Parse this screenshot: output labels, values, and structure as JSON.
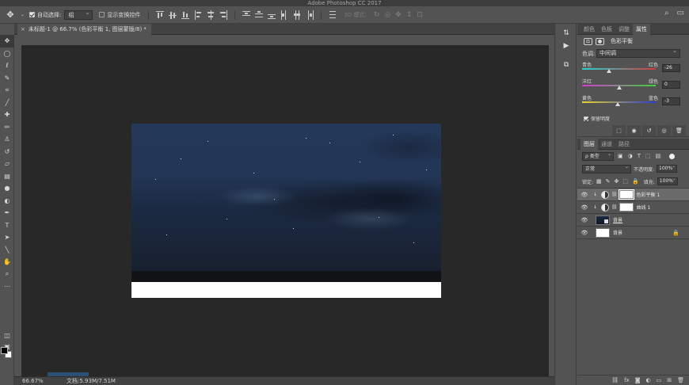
{
  "app": {
    "window_title": "Adobe Photoshop CC 2017"
  },
  "options_bar": {
    "auto_select_label": "自动选择:",
    "auto_select_value": "组",
    "show_transform_label": "显示变换控件",
    "mode_3d_label": "3D 模式:"
  },
  "document_tab": {
    "title": "未标题-1 @ 66.7% (色彩平衡 1, 图层蒙版/8) *",
    "close": "×"
  },
  "status_bar": {
    "zoom": "66.67%",
    "doc_size": "文档:5.93M/7.51M"
  },
  "panel_tabs": [
    {
      "label": "颜色",
      "active": false
    },
    {
      "label": "色板",
      "active": false
    },
    {
      "label": "调整",
      "active": false
    },
    {
      "label": "属性",
      "active": true
    }
  ],
  "properties": {
    "title": "色彩平衡",
    "tone_label": "色调:",
    "tone_value": "中间调",
    "sliders": [
      {
        "left": "青色",
        "right": "红色",
        "value": -26,
        "display": "-26",
        "track": "linear-gradient(90deg,#25d6d6,#d43a3a)"
      },
      {
        "left": "洋红",
        "right": "绿色",
        "value": 0,
        "display": "0",
        "track": "linear-gradient(90deg,#d43ad4,#3ad43a)"
      },
      {
        "left": "黄色",
        "right": "蓝色",
        "value": -3,
        "display": "-3",
        "track": "linear-gradient(90deg,#e8d82a,#2a3ad8)"
      }
    ],
    "preserve_label": "保留明度"
  },
  "layers_tabs": [
    {
      "label": "图层",
      "active": true
    },
    {
      "label": "通道",
      "active": false
    },
    {
      "label": "路径",
      "active": false
    }
  ],
  "layers_panel": {
    "filter_kind": "ρ 类型",
    "blend_mode": "正常",
    "opacity_label": "不透明度:",
    "opacity_value": "100%",
    "lock_label": "锁定:",
    "fill_label": "填充:",
    "fill_value": "100%"
  },
  "layers": [
    {
      "name": "色彩平衡 1",
      "type": "adjustment",
      "selected": true
    },
    {
      "name": "曲线 1",
      "type": "adjustment",
      "selected": false
    },
    {
      "name": "背景",
      "type": "image",
      "selected": false,
      "underline": true
    },
    {
      "name": "背景",
      "type": "white",
      "selected": false,
      "locked": true
    }
  ]
}
